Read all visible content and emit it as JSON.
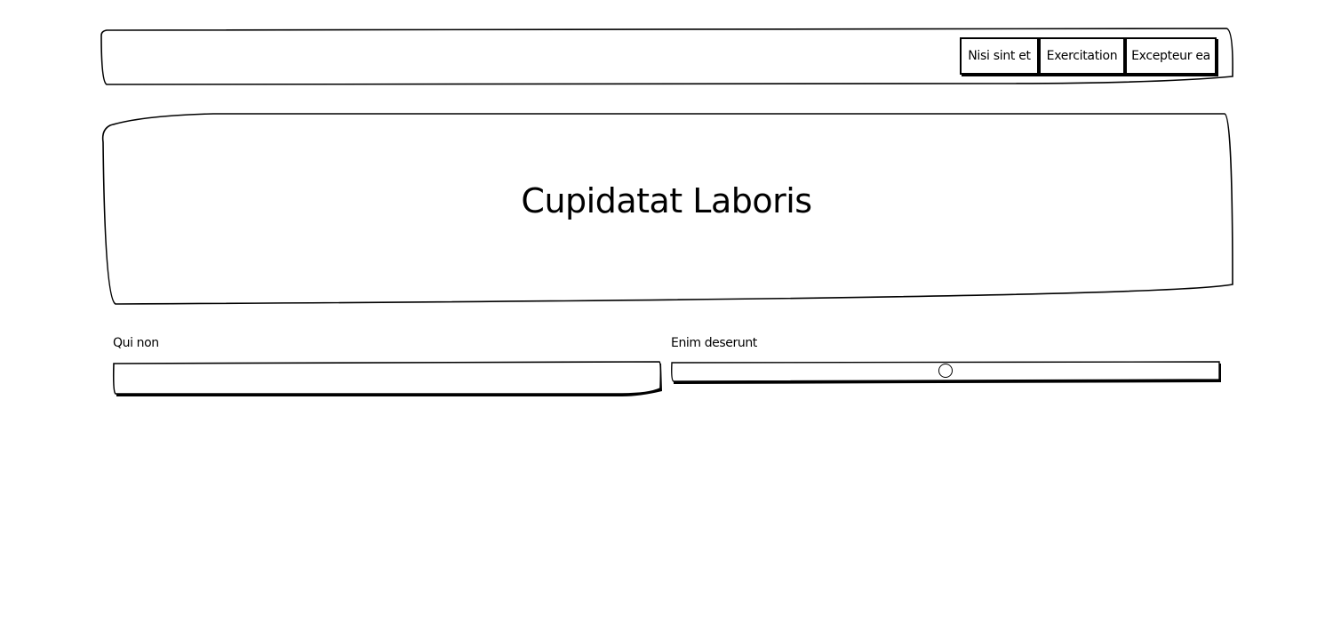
{
  "nav": {
    "items": [
      {
        "label": "Nisi sint et"
      },
      {
        "label": "Exercitation"
      },
      {
        "label": "Excepteur ea"
      }
    ]
  },
  "hero": {
    "title": "Cupidatat Laboris"
  },
  "form": {
    "text_field": {
      "label": "Qui non",
      "value": "",
      "placeholder": ""
    },
    "slider": {
      "label": "Enim deserunt",
      "value_fraction": 0.5
    }
  }
}
